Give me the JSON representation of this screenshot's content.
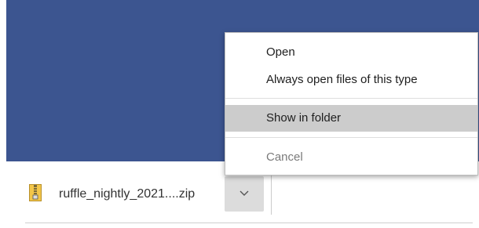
{
  "download": {
    "file_name": "ruffle_nightly_2021....zip",
    "icon": "zip-file-icon"
  },
  "menu": {
    "open": "Open",
    "always_open": "Always open files of this type",
    "show_in_folder": "Show in folder",
    "cancel": "Cancel"
  },
  "colors": {
    "page_background": "#3c5590",
    "highlight": "#cccccc"
  }
}
